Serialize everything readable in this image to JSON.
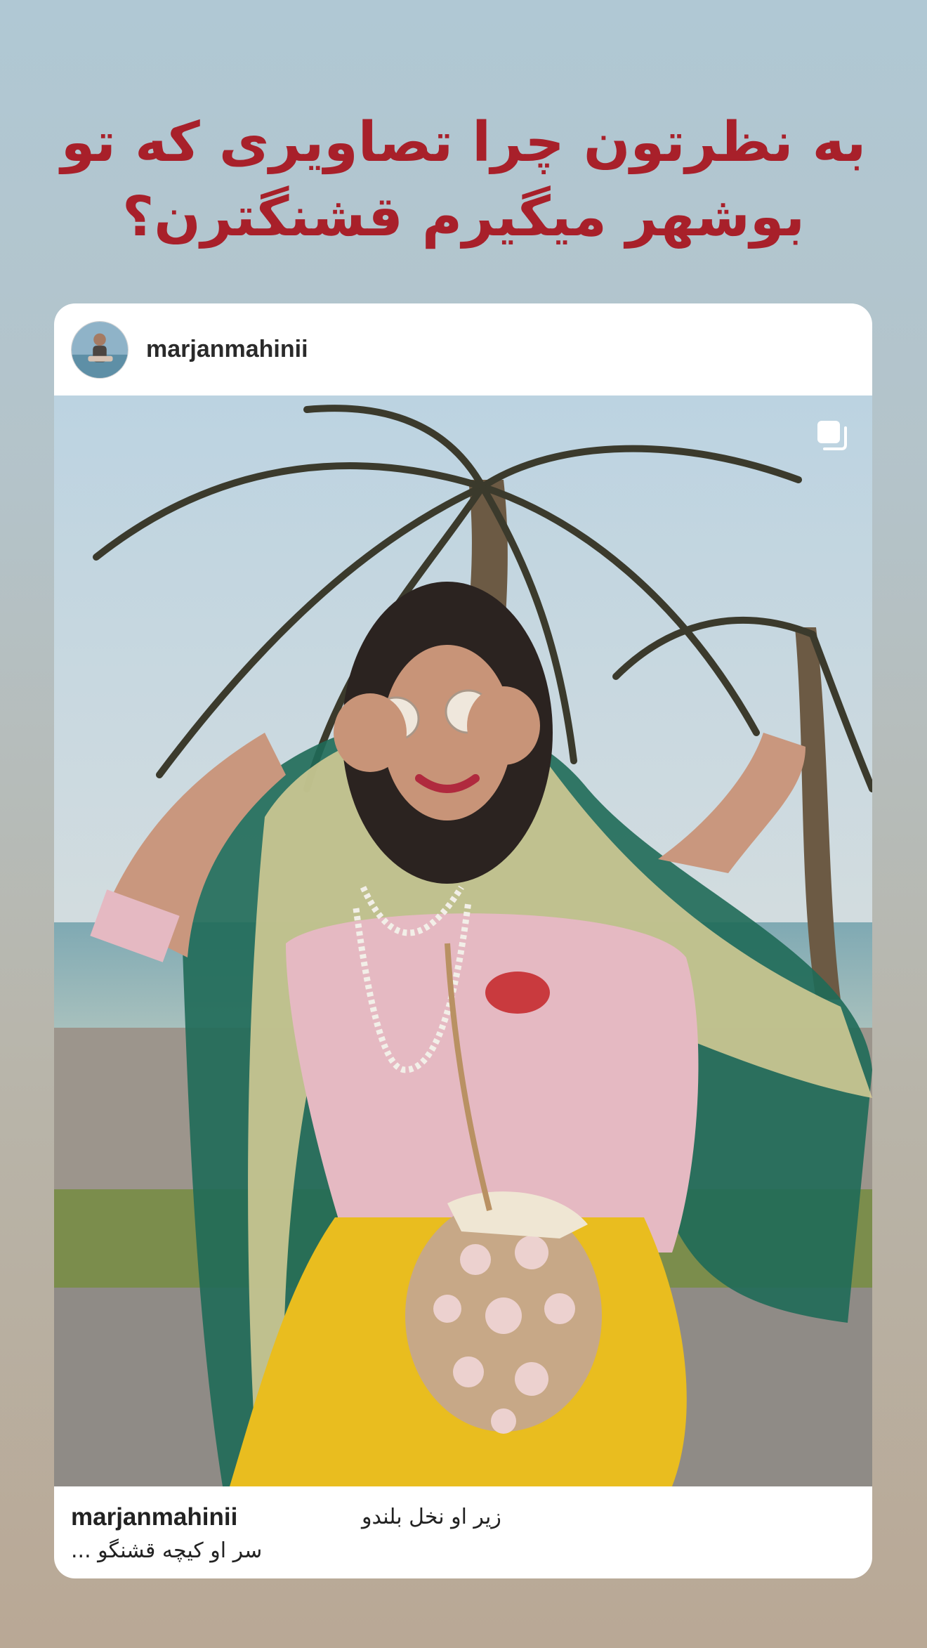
{
  "headline": {
    "line1": "به نظرتون چرا تصاویری که تو",
    "line2": "بوشهر میگیرم قشنگترن؟"
  },
  "post": {
    "username": "marjanmahinii",
    "avatar_icon": "profile-avatar",
    "carousel_icon": "multiple-images-icon",
    "caption_username": "marjanmahinii",
    "caption_line1": "زیر او نخل بلندو",
    "caption_line2": "سر او کیچه قشنگو ..."
  },
  "colors": {
    "headline": "#a8202a",
    "card_background": "#ffffff",
    "page_top": "#b0c8d4",
    "page_bottom": "#b9a895"
  }
}
